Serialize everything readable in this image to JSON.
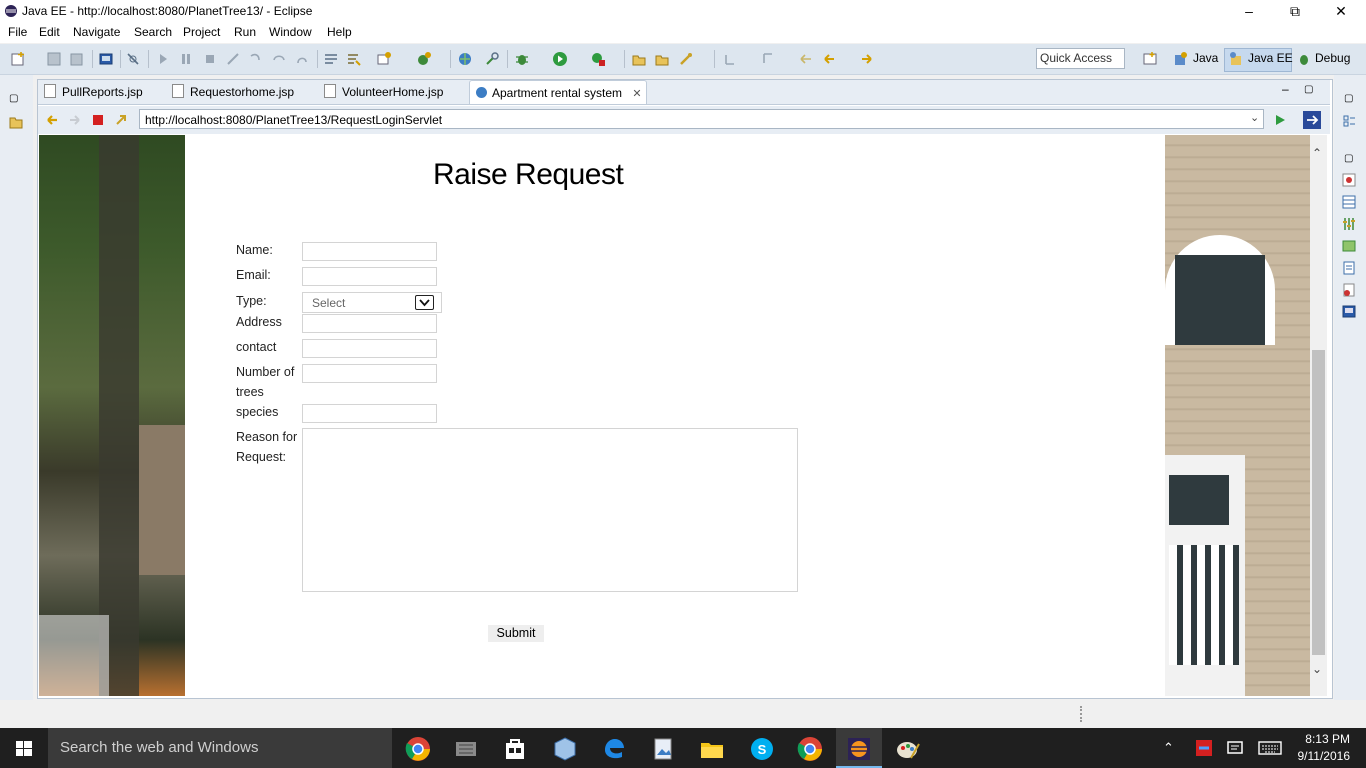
{
  "window": {
    "title": "Java EE - http://localhost:8080/PlanetTree13/ - Eclipse"
  },
  "menu": [
    "File",
    "Edit",
    "Navigate",
    "Search",
    "Project",
    "Run",
    "Window",
    "Help"
  ],
  "toolbar": {
    "quick_access": "Quick Access",
    "perspectives": [
      "Java",
      "Java EE",
      "Debug"
    ]
  },
  "tabs": [
    {
      "label": "PullReports.jsp"
    },
    {
      "label": "Requestorhome.jsp"
    },
    {
      "label": "VolunteerHome.jsp"
    },
    {
      "label": "Apartment rental system"
    }
  ],
  "browser": {
    "url": "http://localhost:8080/PlanetTree13/RequestLoginServlet"
  },
  "page": {
    "heading": "Raise Request",
    "labels": {
      "name": "Name:",
      "email": "Email:",
      "type": "Type:",
      "address": "Address",
      "contact": "contact",
      "trees_line1": "Number of",
      "trees_line2": "trees",
      "species": "species",
      "reason_line1": "Reason for",
      "reason_line2": "Request:"
    },
    "type_select": "Select",
    "submit": "Submit"
  },
  "taskbar": {
    "search": "Search the web and Windows",
    "time": "8:13 PM",
    "date": "9/11/2016"
  }
}
